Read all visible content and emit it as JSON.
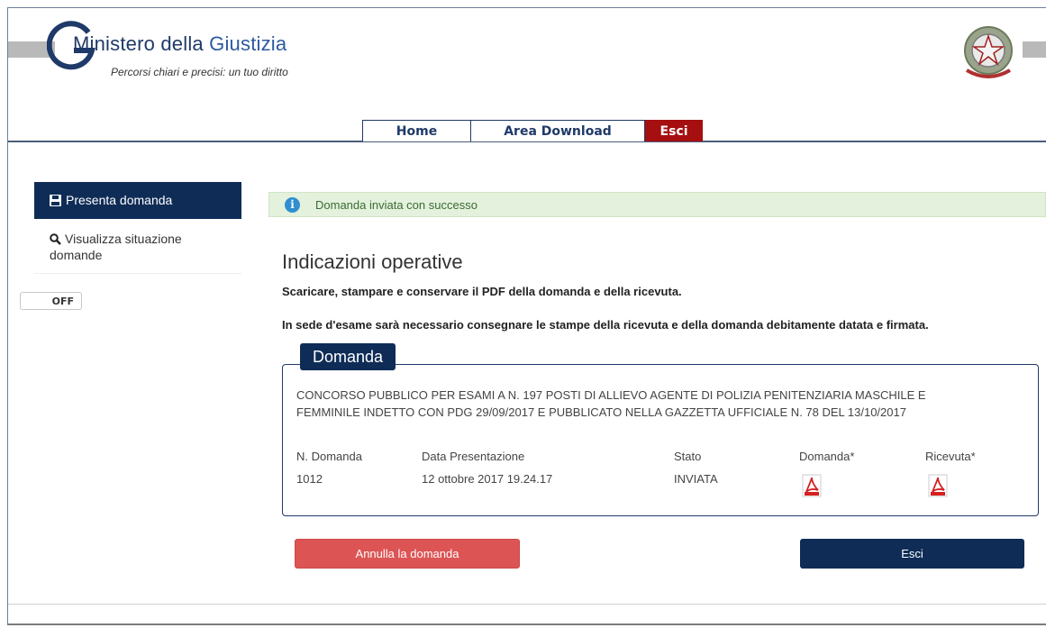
{
  "header": {
    "title_part1": "Ministero della ",
    "title_part2": "Giustizia",
    "subtitle": "Percorsi chiari e precisi: un tuo diritto",
    "logo_icon": "ministry-g-logo",
    "emblem_icon": "italian-republic-emblem"
  },
  "nav": {
    "home": "Home",
    "download": "Area Download",
    "exit": "Esci",
    "exit_color": "#a50f0f"
  },
  "sidebar": {
    "items": [
      {
        "label": "Presenta domanda",
        "icon": "floppy-disk-icon",
        "active": true
      },
      {
        "label": "Visualizza situazione domande",
        "icon": "search-icon",
        "active": false
      }
    ],
    "toggle_label": "OFF",
    "accent": "#0f2c57"
  },
  "alert": {
    "message": "Domanda inviata con successo",
    "icon": "info-icon"
  },
  "main": {
    "heading": "Indicazioni operative",
    "instruction1": "Scaricare, stampare e conservare il PDF della domanda e della ricevuta.",
    "instruction2": "In sede d'esame sarà necessario consegnare le stampe della ricevuta e della domanda debitamente datata e firmata."
  },
  "domanda": {
    "legend": "Domanda",
    "contest_line1": "CONCORSO PUBBLICO PER ESAMI A N. 197 POSTI DI ALLIEVO AGENTE DI POLIZIA PENITENZIARIA MASCHILE E",
    "contest_line2": "FEMMINILE INDETTO CON PDG 29/09/2017 E PUBBLICATO NELLA GAZZETTA UFFICIALE N. 78 DEL 13/10/2017",
    "columns": {
      "number": "N. Domanda",
      "date": "Data Presentazione",
      "status": "Stato",
      "application_pdf": "Domanda*",
      "receipt_pdf": "Ricevuta*"
    },
    "row": {
      "number": "1012",
      "date": "12 ottobre 2017 19.24.17",
      "status": "INVIATA"
    },
    "pdf_icon": "pdf-icon"
  },
  "buttons": {
    "cancel": "Annulla la domanda",
    "exit": "Esci",
    "cancel_color": "#dd5454",
    "exit_color": "#0f2c57"
  }
}
